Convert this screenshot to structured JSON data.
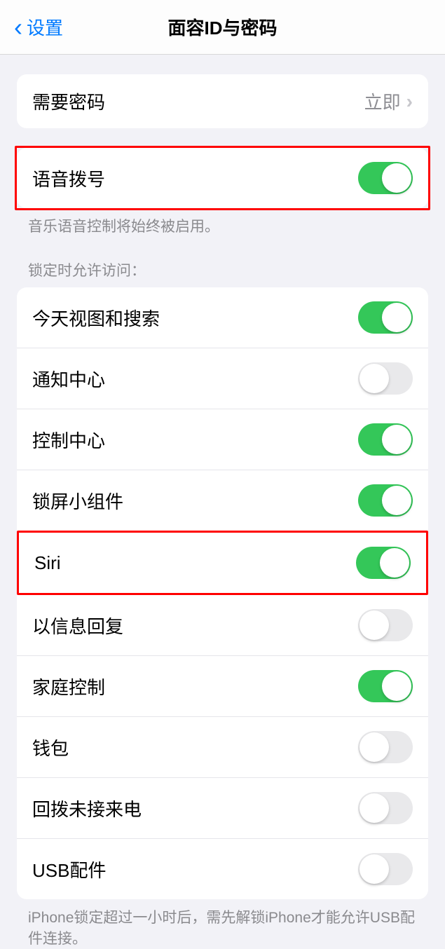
{
  "header": {
    "back_label": "设置",
    "title": "面容ID与密码"
  },
  "require_passcode": {
    "label": "需要密码",
    "value": "立即"
  },
  "voice_dial": {
    "label": "语音拨号",
    "on": true,
    "footer": "音乐语音控制将始终被启用。"
  },
  "lock_access": {
    "header": "锁定时允许访问：",
    "items": [
      {
        "label": "今天视图和搜索",
        "on": true
      },
      {
        "label": "通知中心",
        "on": false
      },
      {
        "label": "控制中心",
        "on": true
      },
      {
        "label": "锁屏小组件",
        "on": true
      },
      {
        "label": "Siri",
        "on": true
      },
      {
        "label": "以信息回复",
        "on": false
      },
      {
        "label": "家庭控制",
        "on": true
      },
      {
        "label": "钱包",
        "on": false
      },
      {
        "label": "回拨未接来电",
        "on": false
      },
      {
        "label": "USB配件",
        "on": false
      }
    ],
    "footer": "iPhone锁定超过一小时后，需先解锁iPhone才能允许USB配件连接。"
  }
}
